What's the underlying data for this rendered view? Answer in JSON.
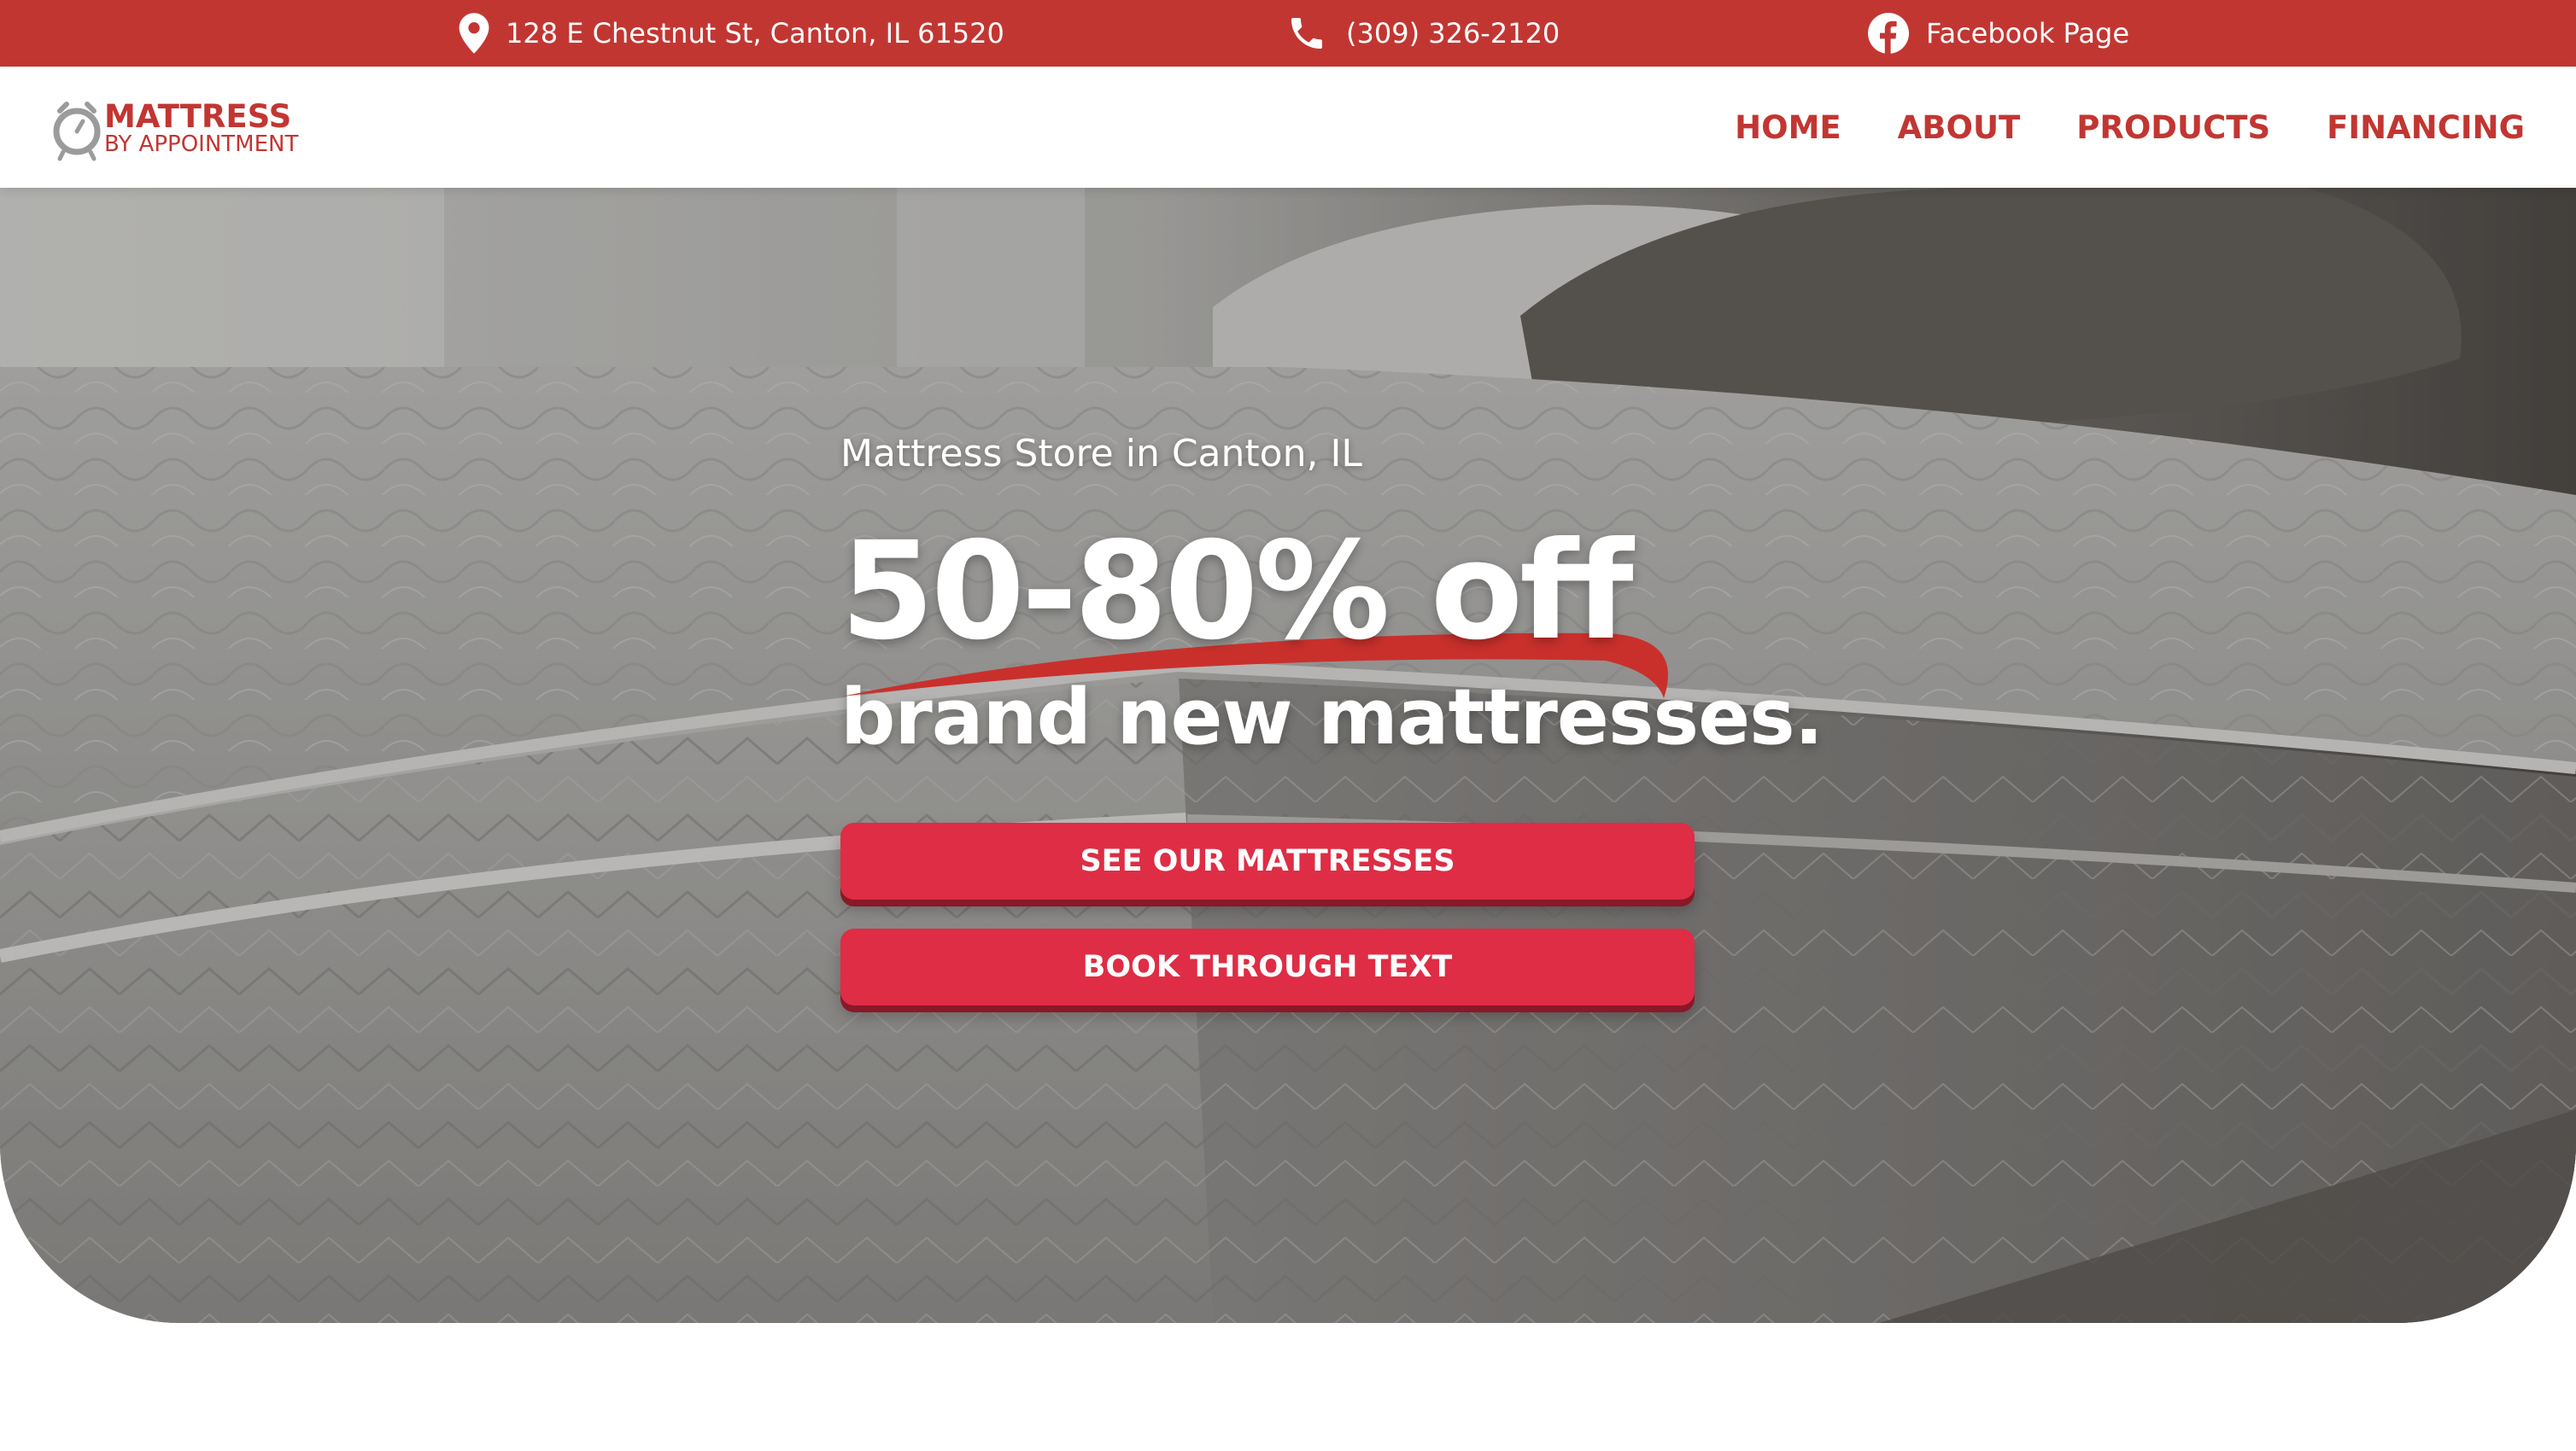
{
  "topbar": {
    "address": "128 E Chestnut St, Canton, IL 61520",
    "address_icon": "location-pin-icon",
    "phone": "(309) 326-2120",
    "phone_icon": "phone-icon",
    "facebook": "Facebook Page",
    "facebook_icon": "facebook-icon"
  },
  "logo": {
    "line1": "MATTRESS",
    "line2": "BY APPOINTMENT",
    "icon": "alarm-clock-icon"
  },
  "nav": {
    "items": [
      {
        "label": "HOME"
      },
      {
        "label": "ABOUT"
      },
      {
        "label": "PRODUCTS"
      },
      {
        "label": "FINANCING"
      }
    ]
  },
  "hero": {
    "eyebrow": "Mattress Store in Canton, IL",
    "headline": "50-80% off",
    "subheadline": "brand new mattresses.",
    "cta_primary": "SEE OUR MATTRESSES",
    "cta_secondary": "BOOK THROUGH TEXT"
  },
  "colors": {
    "brand_red": "#c23632",
    "button_red": "#de2d45",
    "button_shadow": "#8a1828",
    "white": "#ffffff"
  }
}
